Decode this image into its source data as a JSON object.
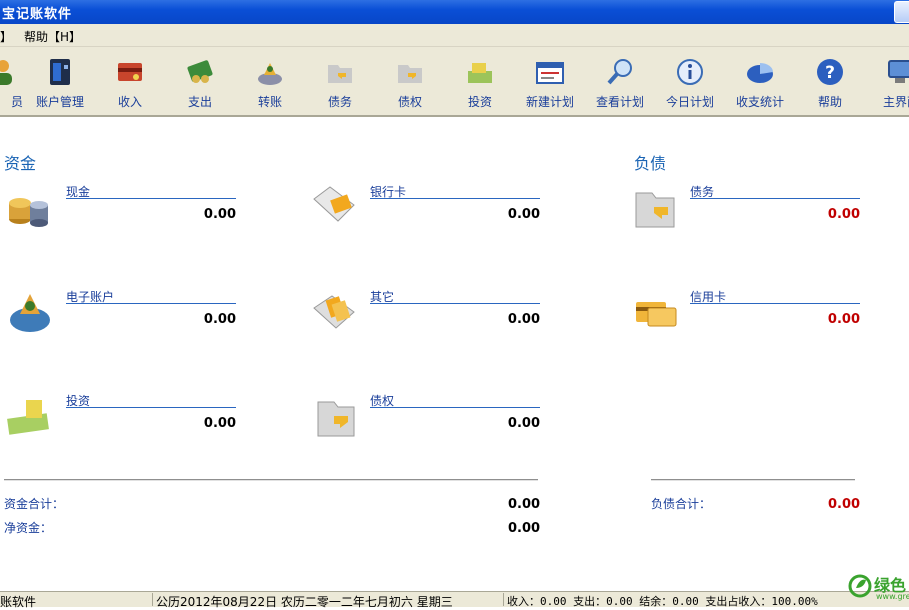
{
  "window": {
    "title": "宝记账软件"
  },
  "menu": {
    "items": [
      "】",
      "帮助【H】"
    ]
  },
  "toolbar": {
    "items": [
      {
        "label": "员",
        "icon": "member-icon"
      },
      {
        "label": "账户管理",
        "icon": "account-manage-icon"
      },
      {
        "label": "收入",
        "icon": "income-icon"
      },
      {
        "label": "支出",
        "icon": "expense-icon"
      },
      {
        "label": "转账",
        "icon": "transfer-icon"
      },
      {
        "label": "债务",
        "icon": "debt-icon"
      },
      {
        "label": "债权",
        "icon": "credit-icon"
      },
      {
        "label": "投资",
        "icon": "invest-icon"
      },
      {
        "label": "新建计划",
        "icon": "new-plan-icon"
      },
      {
        "label": "查看计划",
        "icon": "view-plan-icon"
      },
      {
        "label": "今日计划",
        "icon": "today-plan-icon"
      },
      {
        "label": "收支统计",
        "icon": "stats-icon"
      },
      {
        "label": "帮助",
        "icon": "help-icon"
      },
      {
        "label": "主界面",
        "icon": "home-icon"
      }
    ]
  },
  "assets": {
    "title": "资金",
    "accounts": [
      {
        "name": "现金",
        "amount": "0.00",
        "icon": "cash-coins-icon"
      },
      {
        "name": "银行卡",
        "amount": "0.00",
        "icon": "bank-card-icon"
      },
      {
        "name": "电子账户",
        "amount": "0.00",
        "icon": "e-account-icon"
      },
      {
        "name": "其它",
        "amount": "0.00",
        "icon": "other-icon"
      },
      {
        "name": "投资",
        "amount": "0.00",
        "icon": "invest-money-icon"
      },
      {
        "name": "债权",
        "amount": "0.00",
        "icon": "credit-folder-icon"
      }
    ],
    "total_label": "资金合计：",
    "total": "0.00",
    "net_label": "净资金：",
    "net": "0.00"
  },
  "liabilities": {
    "title": "负债",
    "accounts": [
      {
        "name": "债务",
        "amount": "0.00",
        "icon": "debt-folder-icon"
      },
      {
        "name": "信用卡",
        "amount": "0.00",
        "icon": "credit-card-icon"
      }
    ],
    "total_label": "负债合计：",
    "total": "0.00"
  },
  "status": {
    "app": "账软件",
    "date": "公历2012年08月22日 农历二零一二年七月初六  星期三",
    "summary": "收入：0.00 支出：0.00 结余：0.00 支出占收入：100.00%"
  },
  "watermark": {
    "text": "绿色",
    "url": "www.gre"
  },
  "colors": {
    "titlebar": "#0a4fd6",
    "label_blue": "#1a3e9a",
    "section_blue": "#1a64b4",
    "negative_red": "#c00000",
    "chrome": "#ece9d8"
  }
}
